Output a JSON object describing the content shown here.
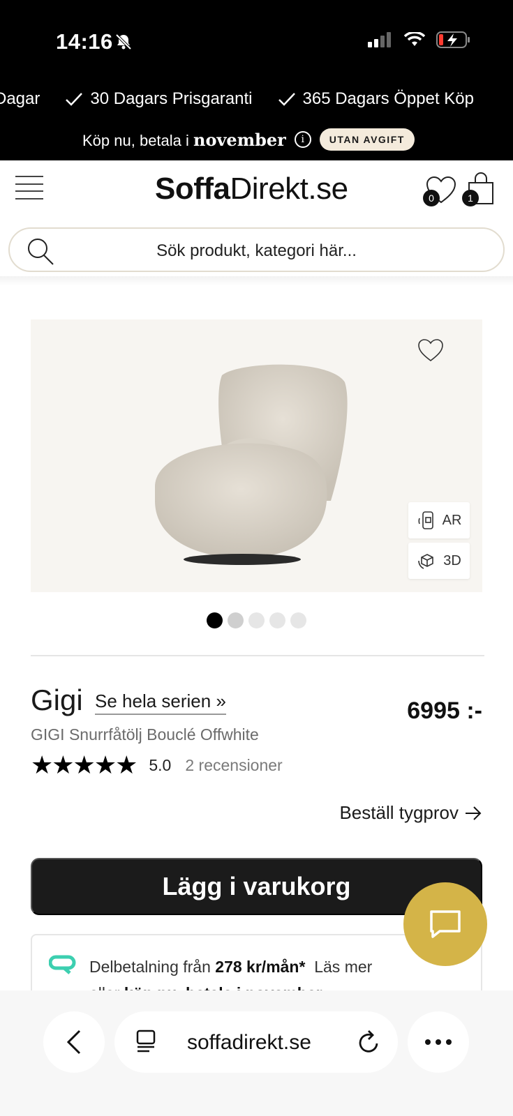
{
  "status_bar": {
    "time": "14:16"
  },
  "promo": {
    "usps": [
      "Dagar",
      "30 Dagars Prisgaranti",
      "365 Dagars Öppet Köp"
    ],
    "pay_text": "Köp nu, betala i",
    "pay_month": "november",
    "badge": "UTAN AVGIFT"
  },
  "header": {
    "logo_bold": "Soffa",
    "logo_regular": "Direkt.se",
    "wishlist_count": "0",
    "cart_count": "1"
  },
  "search": {
    "placeholder": "Sök produkt, kategori här..."
  },
  "gallery": {
    "ar_label": "AR",
    "threed_label": "3D",
    "image_count": 5,
    "active_index": 0
  },
  "product": {
    "name": "Gigi",
    "series_link": "Se hela serien »",
    "price": "6995 :-",
    "subtitle": "GIGI Snurrfåtölj Bouclé Offwhite",
    "stars": "★★★★★",
    "rating": "5.0",
    "reviews": "2 recensioner",
    "sample_link": "Beställ tygprov"
  },
  "cta": {
    "label": "Lägg i varukorg"
  },
  "finance": {
    "prefix": "Delbetalning från",
    "amount": "278 kr/mån*",
    "read_more": "Läs mer",
    "line2_prefix": "eller",
    "line2_bold": "köp nu, betala i november"
  },
  "browser": {
    "url": "soffadirekt.se"
  },
  "colors": {
    "accent_chat": "#d4b448",
    "cta_bg": "#1b1b1b",
    "badge_bg": "#f4ebdc",
    "finance_icon": "#3ccfb0"
  }
}
